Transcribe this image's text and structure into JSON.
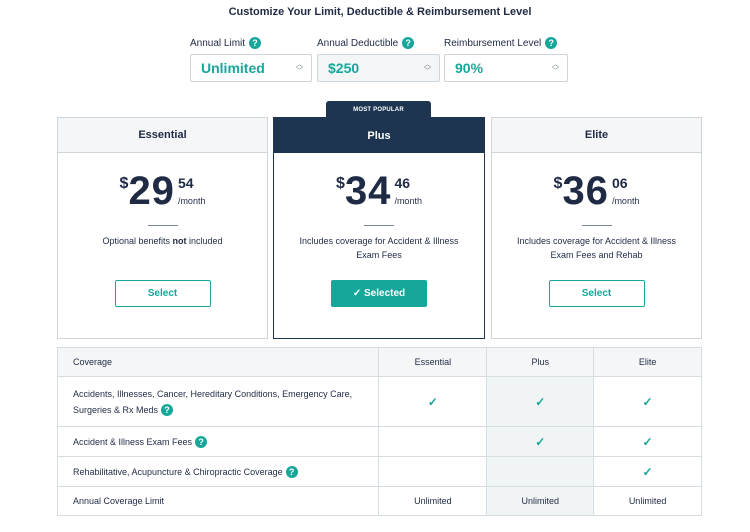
{
  "page_title": "Customize Your Limit, Deductible & Reimbursement Level",
  "selectors": [
    {
      "label": "Annual Limit",
      "value": "Unlimited"
    },
    {
      "label": "Annual Deductible",
      "value": "$250"
    },
    {
      "label": "Reimbursement Level",
      "value": "90%"
    }
  ],
  "help_glyph": "?",
  "featured_badge": "MOST POPULAR",
  "plans": [
    {
      "name": "Essential",
      "dollar": "$",
      "price_int": "29",
      "price_cents": "54",
      "per": "/month",
      "desc_pre": "Optional benefits ",
      "desc_bold": "not",
      "desc_post": " included",
      "button": "Select"
    },
    {
      "name": "Plus",
      "dollar": "$",
      "price_int": "34",
      "price_cents": "46",
      "per": "/month",
      "desc": "Includes coverage for Accident & Illness Exam Fees",
      "button": "✓ Selected"
    },
    {
      "name": "Elite",
      "dollar": "$",
      "price_int": "36",
      "price_cents": "06",
      "per": "/month",
      "desc": "Includes coverage for Accident & Illness Exam Fees and Rehab",
      "button": "Select"
    }
  ],
  "coverage_table": {
    "headers": [
      "Coverage",
      "Essential",
      "Plus",
      "Elite"
    ],
    "rows": [
      {
        "label": "Accidents, Illnesses, Cancer, Hereditary Conditions, Emergency Care, Surgeries & Rx Meds",
        "values": [
          "✓",
          "✓",
          "✓"
        ]
      },
      {
        "label": "Accident & Illness Exam Fees",
        "values": [
          "",
          "✓",
          "✓"
        ]
      },
      {
        "label": "Rehabilitative, Acupuncture & Chiropractic Coverage",
        "values": [
          "",
          "",
          "✓"
        ]
      },
      {
        "label": "Annual Coverage Limit",
        "values": [
          "Unlimited",
          "Unlimited",
          "Unlimited"
        ]
      }
    ]
  },
  "colors": {
    "accent": "#16a79a",
    "navy": "#1d3550",
    "text": "#1f2a44"
  }
}
